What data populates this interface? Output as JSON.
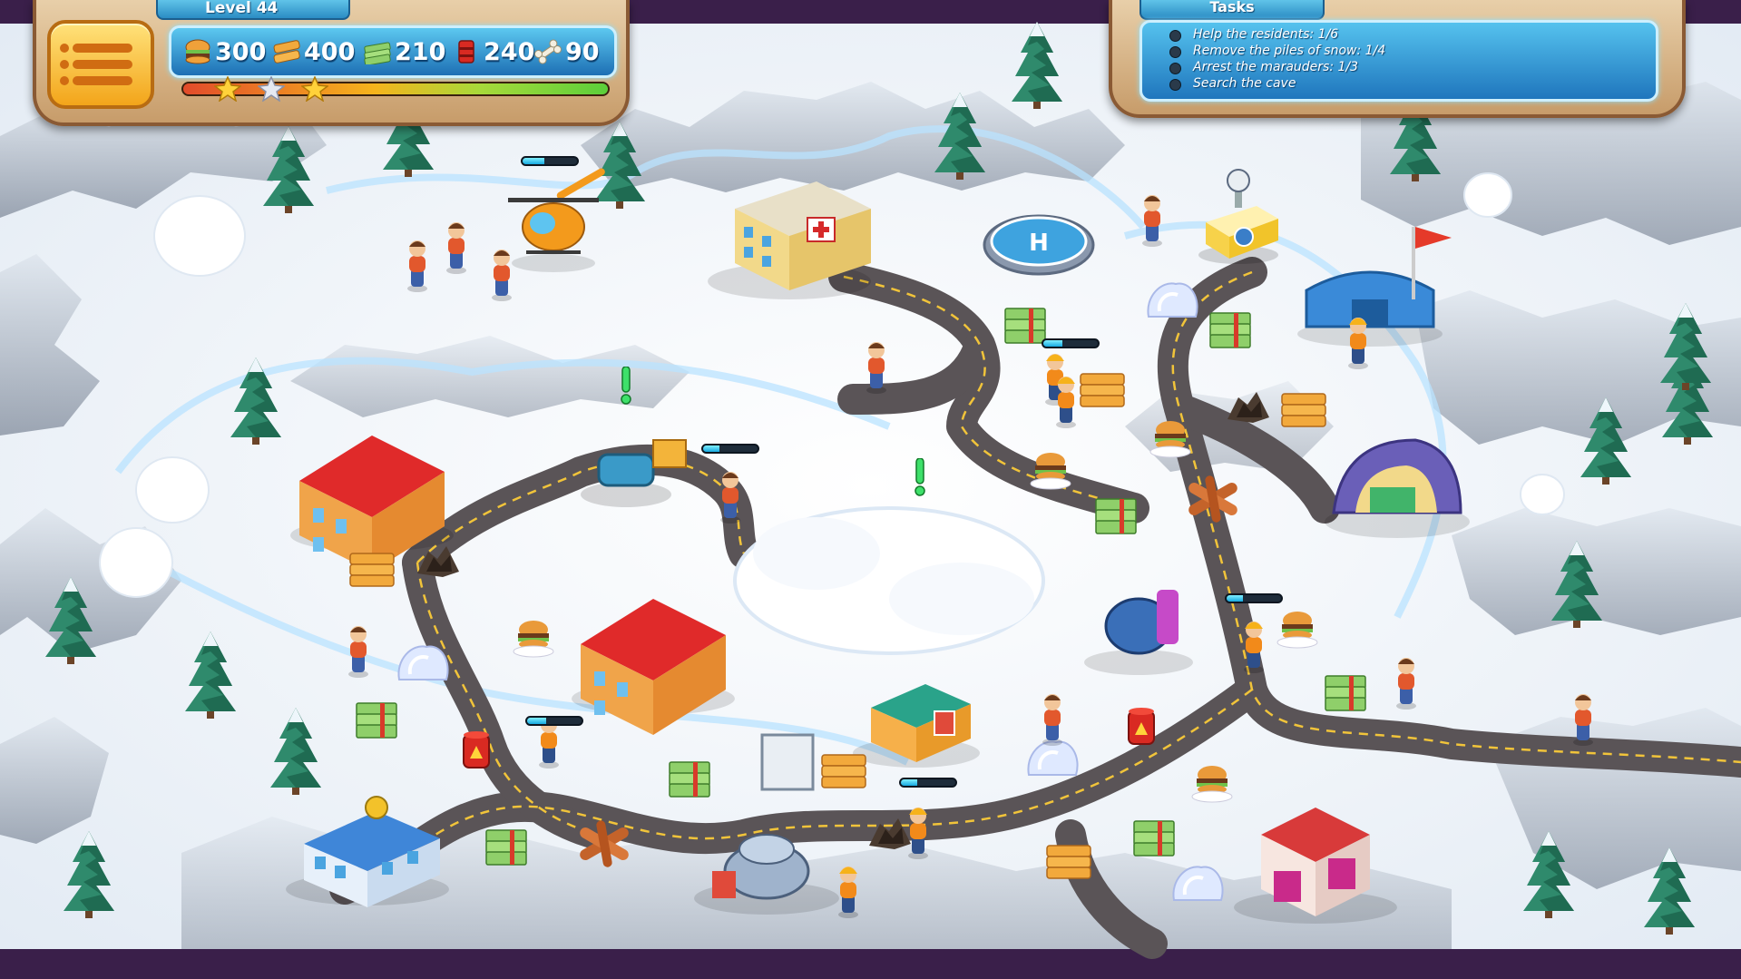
{
  "hud": {
    "level_label": "Level 44",
    "menu_icon": "list-menu-icon",
    "resources": [
      {
        "icon": "food-burger-icon",
        "value": "300"
      },
      {
        "icon": "wood-plank-icon",
        "value": "400"
      },
      {
        "icon": "money-stack-icon",
        "value": "210"
      },
      {
        "icon": "fuel-barrel-icon",
        "value": "240"
      },
      {
        "icon": "bone-icon",
        "value": "90"
      }
    ],
    "time_progress": 1.0,
    "stars": [
      "gold-star-icon",
      "silver-star-icon",
      "gold-star-icon"
    ]
  },
  "tasks": {
    "title": "Tasks",
    "items": [
      "Help the residents: 1/6",
      "Remove the piles of snow: 1/4",
      "Arrest the marauders: 1/3",
      "Search the cave"
    ]
  },
  "colors": {
    "frame": "#3a1f4a",
    "snow": "#f4f7fb",
    "road": "#6f6a6c",
    "road_line": "#f1c43a",
    "hud_blue": "#2b8cc4",
    "hud_wood": "#c79c6a"
  },
  "map_objects": {
    "hospital": "hospital-building",
    "helipad": "helipad",
    "helicopter": "rescue-helicopter",
    "news_van": "news-van",
    "workers_camp": "workers-camp-tent",
    "police_station": "police-station",
    "fire_station": "fire-station",
    "house_a": "red-roof-house",
    "house_b": "red-roof-house",
    "workshop": "workshop-building",
    "lab": "lab-dome-building",
    "cave": "cave-entrance",
    "snow_field": "snow-field-obstacle"
  }
}
